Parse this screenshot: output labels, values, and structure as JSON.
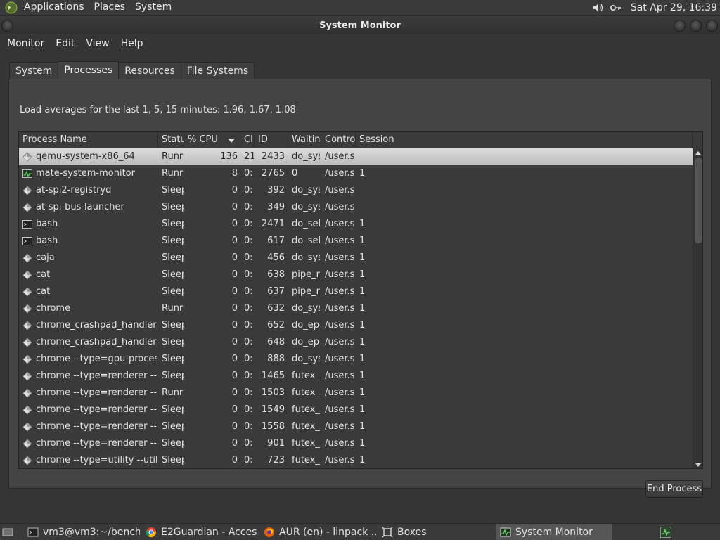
{
  "top_panel": {
    "menus": [
      "Applications",
      "Places",
      "System"
    ],
    "clock": "Sat Apr 29, 16:39"
  },
  "window": {
    "title": "System Monitor",
    "menubar": [
      "Monitor",
      "Edit",
      "View",
      "Help"
    ],
    "tabs": [
      "System",
      "Processes",
      "Resources",
      "File Systems"
    ],
    "active_tab": "Processes",
    "load_averages": "Load averages for the last 1, 5, 15 minutes: 1.96, 1.67, 1.08",
    "columns": [
      "Process Name",
      "Statu",
      "% CPU",
      "CI",
      "ID",
      "Waiting",
      "Control",
      "Session"
    ],
    "rows": [
      {
        "name": "qemu-system-x86_64",
        "status": "Runr",
        "cpu": "136",
        "cputime": "21",
        "id": "2433",
        "wait": "do_sys",
        "ctrl": "/user.s",
        "session": "",
        "icon": "diamond-icon",
        "selected": true
      },
      {
        "name": "mate-system-monitor",
        "status": "Runr",
        "cpu": "8",
        "cputime": "0:",
        "id": "2765",
        "wait": "0",
        "ctrl": "/user.s",
        "session": "1",
        "icon": "monitor-icon"
      },
      {
        "name": "at-spi2-registryd",
        "status": "Sleep",
        "cpu": "0",
        "cputime": "0:",
        "id": "392",
        "wait": "do_sys",
        "ctrl": "/user.s",
        "session": "",
        "icon": "diamond-icon"
      },
      {
        "name": "at-spi-bus-launcher",
        "status": "Sleep",
        "cpu": "0",
        "cputime": "0:",
        "id": "349",
        "wait": "do_sys",
        "ctrl": "/user.s",
        "session": "",
        "icon": "diamond-icon"
      },
      {
        "name": "bash",
        "status": "Sleep",
        "cpu": "0",
        "cputime": "0:",
        "id": "2471",
        "wait": "do_sele",
        "ctrl": "/user.s",
        "session": "1",
        "icon": "terminal-icon"
      },
      {
        "name": "bash",
        "status": "Sleep",
        "cpu": "0",
        "cputime": "0:",
        "id": "617",
        "wait": "do_sele",
        "ctrl": "/user.s",
        "session": "1",
        "icon": "terminal-icon"
      },
      {
        "name": "caja",
        "status": "Sleep",
        "cpu": "0",
        "cputime": "0:",
        "id": "456",
        "wait": "do_sys",
        "ctrl": "/user.s",
        "session": "1",
        "icon": "diamond-icon"
      },
      {
        "name": "cat",
        "status": "Sleep",
        "cpu": "0",
        "cputime": "0:",
        "id": "638",
        "wait": "pipe_re",
        "ctrl": "/user.s",
        "session": "1",
        "icon": "diamond-icon"
      },
      {
        "name": "cat",
        "status": "Sleep",
        "cpu": "0",
        "cputime": "0:",
        "id": "637",
        "wait": "pipe_re",
        "ctrl": "/user.s",
        "session": "1",
        "icon": "diamond-icon"
      },
      {
        "name": "chrome",
        "status": "Runr",
        "cpu": "0",
        "cputime": "0:",
        "id": "632",
        "wait": "do_sys",
        "ctrl": "/user.s",
        "session": "1",
        "icon": "diamond-icon"
      },
      {
        "name": "chrome_crashpad_handler",
        "status": "Sleep",
        "cpu": "0",
        "cputime": "0:",
        "id": "652",
        "wait": "do_epo",
        "ctrl": "/user.s",
        "session": "1",
        "icon": "diamond-icon"
      },
      {
        "name": "chrome_crashpad_handler",
        "status": "Sleep",
        "cpu": "0",
        "cputime": "0:",
        "id": "648",
        "wait": "do_epo",
        "ctrl": "/user.s",
        "session": "1",
        "icon": "diamond-icon"
      },
      {
        "name": "chrome --type=gpu-process --",
        "status": "Sleep",
        "cpu": "0",
        "cputime": "0:",
        "id": "888",
        "wait": "do_sys",
        "ctrl": "/user.s",
        "session": "1",
        "icon": "diamond-icon"
      },
      {
        "name": "chrome --type=renderer --cras",
        "status": "Sleep",
        "cpu": "0",
        "cputime": "0:",
        "id": "1465",
        "wait": "futex_w",
        "ctrl": "/user.s",
        "session": "1",
        "icon": "diamond-icon"
      },
      {
        "name": "chrome --type=renderer --cras",
        "status": "Runr",
        "cpu": "0",
        "cputime": "0:",
        "id": "1503",
        "wait": "futex_w",
        "ctrl": "/user.s",
        "session": "1",
        "icon": "diamond-icon"
      },
      {
        "name": "chrome --type=renderer --cras",
        "status": "Sleep",
        "cpu": "0",
        "cputime": "0:",
        "id": "1549",
        "wait": "futex_w",
        "ctrl": "/user.s",
        "session": "1",
        "icon": "diamond-icon"
      },
      {
        "name": "chrome --type=renderer --cras",
        "status": "Sleep",
        "cpu": "0",
        "cputime": "0:",
        "id": "1558",
        "wait": "futex_w",
        "ctrl": "/user.s",
        "session": "1",
        "icon": "diamond-icon"
      },
      {
        "name": "chrome --type=renderer --cras",
        "status": "Sleep",
        "cpu": "0",
        "cputime": "0:",
        "id": "901",
        "wait": "futex_w",
        "ctrl": "/user.s",
        "session": "1",
        "icon": "diamond-icon"
      },
      {
        "name": "chrome --type=utility --utility-s",
        "status": "Sleep",
        "cpu": "0",
        "cputime": "0:",
        "id": "723",
        "wait": "futex_w",
        "ctrl": "/user.s",
        "session": "1",
        "icon": "diamond-icon"
      }
    ],
    "end_process_label": "End Process"
  },
  "taskbar": {
    "tasks": [
      {
        "label": "vm3@vm3:~/bench...",
        "icon": "terminal-icon"
      },
      {
        "label": "E2Guardian - Acces...",
        "icon": "chrome-icon"
      },
      {
        "label": "AUR (en) - linpack ...",
        "icon": "firefox-icon"
      },
      {
        "label": "Boxes",
        "icon": "boxes-icon"
      },
      {
        "label": "System Monitor",
        "icon": "monitor-icon"
      }
    ]
  }
}
